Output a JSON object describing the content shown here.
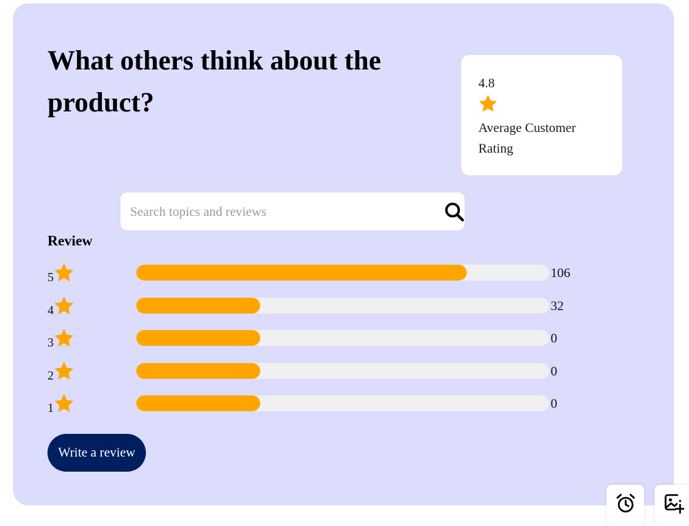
{
  "heading": "What others think about the product?",
  "rating": {
    "value": "4.8",
    "caption": "Average Customer Rating",
    "icon": "star-icon"
  },
  "search": {
    "placeholder": "Search topics and reviews",
    "value": "",
    "icon": "search-icon"
  },
  "review_label": "Review",
  "breakdown": [
    {
      "stars": "5",
      "count": "106",
      "fill_fraction": 0.8
    },
    {
      "stars": "4",
      "count": "32",
      "fill_fraction": 0.3
    },
    {
      "stars": "3",
      "count": "0",
      "fill_fraction": 0.3
    },
    {
      "stars": "2",
      "count": "0",
      "fill_fraction": 0.3
    },
    {
      "stars": "1",
      "count": "0",
      "fill_fraction": 0.3
    }
  ],
  "write_review_label": "Write a review",
  "floating_buttons": [
    {
      "icon": "alarm-clock-icon"
    },
    {
      "icon": "add-image-icon"
    }
  ],
  "colors": {
    "card_background": "#dcdcfd",
    "star": "#ffa500",
    "bar_fill": "#ffa500",
    "bar_track": "#f0f0f0",
    "button": "#001f60"
  }
}
